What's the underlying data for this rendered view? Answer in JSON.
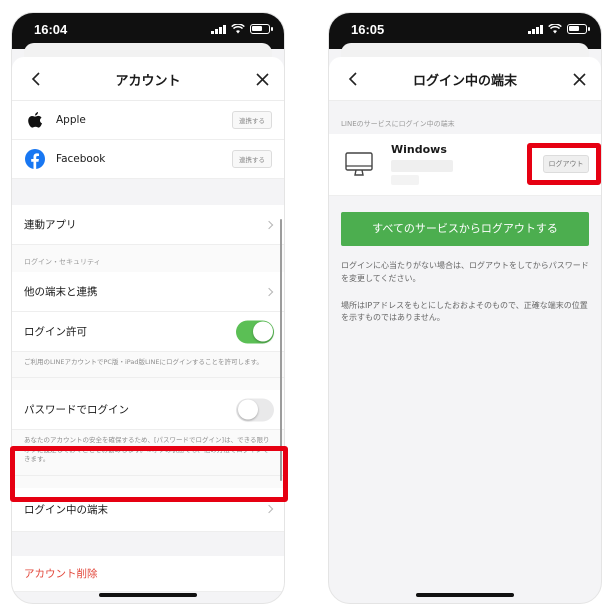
{
  "left": {
    "status_time": "16:04",
    "nav_title": "アカウント",
    "apps": [
      {
        "label": "Apple",
        "button": "連携する"
      },
      {
        "label": "Facebook",
        "button": "連携する"
      }
    ],
    "linked_apps_label": "連動アプリ",
    "security_section_label": "ログイン・セキュリティ",
    "other_devices_label": "他の端末と連携",
    "login_permission_label": "ログイン許可",
    "login_permission_note": "ご利用のLINEアカウントでPC版・iPad版LINEにログインすることを許可します。",
    "password_login_label": "パスワードでログイン",
    "password_login_note": "あなたのアカウントの安全を確保するため、[パスワードでログイン]は、できる限りオフに設定しておくことをお勧めします。※オフの状態でも、他の方法でログインできます。",
    "logged_in_devices_label": "ログイン中の端末",
    "delete_account_label": "アカウント削除"
  },
  "right": {
    "status_time": "16:05",
    "nav_title": "ログイン中の端末",
    "section_label": "LINEのサービスにログイン中の端末",
    "device_name": "Windows",
    "logout_button": "ログアウト",
    "logout_all_button": "すべてのサービスからログアウトする",
    "info1": "ログインに心当たりがない場合は、ログアウトをしてからパスワードを変更してください。",
    "info2": "場所はIPアドレスをもとにしたおおよそのもので、正確な端末の位置を示すものではありません。"
  },
  "colors": {
    "highlight": "#e60012",
    "toggle_on": "#5bbf55",
    "line_green": "#4cae4f",
    "danger": "#e2473b"
  },
  "toggles": {
    "login_permission": true,
    "password_login": false
  }
}
